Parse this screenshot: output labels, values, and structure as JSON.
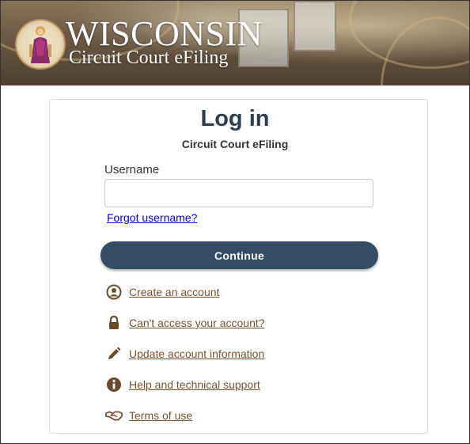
{
  "banner": {
    "title": "WISCONSIN",
    "subtitle": "Circuit Court eFiling"
  },
  "login": {
    "title": "Log in",
    "subtitle": "Circuit Court eFiling",
    "username_label": "Username",
    "username_value": "",
    "username_placeholder": "",
    "forgot_link": "Forgot username?",
    "continue_label": "Continue"
  },
  "links": [
    {
      "label": "Create an account",
      "icon": "user-circle-icon"
    },
    {
      "label": "Can't access your account?",
      "icon": "lock-icon"
    },
    {
      "label": "Update account information",
      "icon": "pencil-icon"
    },
    {
      "label": "Help and technical support",
      "icon": "info-circle-icon"
    },
    {
      "label": "Terms of use",
      "icon": "handshake-icon"
    }
  ],
  "colors": {
    "title": "#2c3e50",
    "button": "#344c64",
    "link": "#7a5230",
    "forgot_link": "#0000cc"
  }
}
